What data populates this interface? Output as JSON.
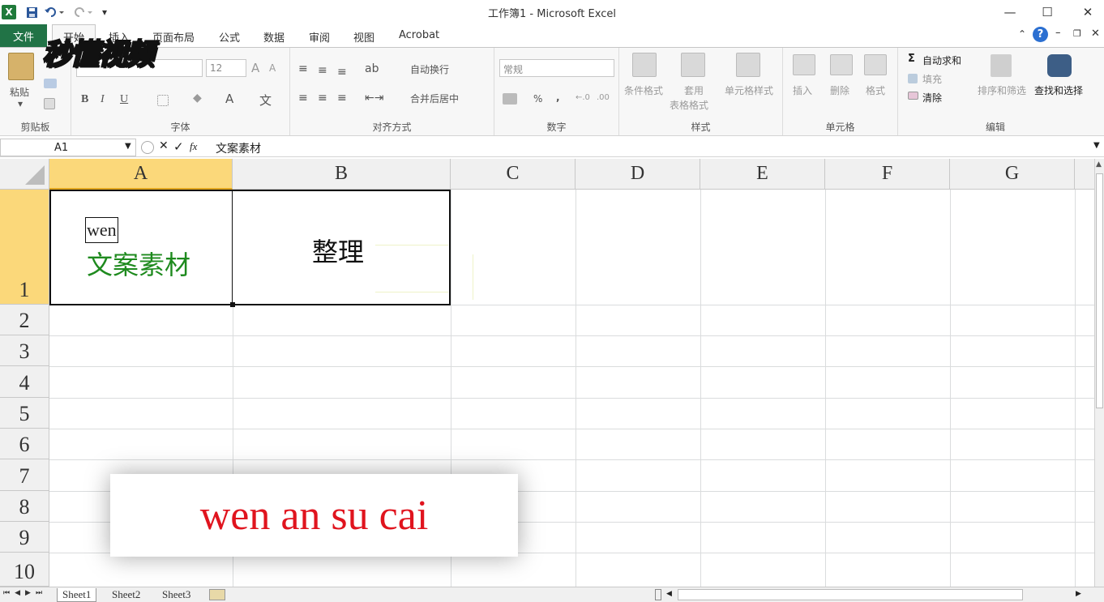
{
  "window": {
    "title": "工作簿1  -  Microsoft Excel",
    "app_logo": "X",
    "qat_dropdown": "▾"
  },
  "watermark": "秒懂视频",
  "ribbon": {
    "tabs": [
      "文件",
      "开始",
      "插入",
      "页面布局",
      "公式",
      "数据",
      "审阅",
      "视图",
      "Acrobat"
    ],
    "active_tab": "开始",
    "clipboard": {
      "paste": "粘贴",
      "label": "剪贴板"
    },
    "font": {
      "size": "12",
      "label": "字体",
      "bold": "B",
      "italic": "I",
      "underline": "U",
      "grow": "A",
      "shrink": "A",
      "color": "A",
      "phonetic": "文",
      "fill": "◆"
    },
    "alignment": {
      "wrap": "自动换行",
      "merge": "合并后居中",
      "label": "对齐方式"
    },
    "number": {
      "format": "常规",
      "percent": "%",
      "comma": ",",
      "inc": "←.0",
      "dec": ".00",
      "label": "数字"
    },
    "styles": {
      "conditional": "条件格式",
      "table1": "套用",
      "table2": "表格格式",
      "cell": "单元格样式",
      "label": "样式"
    },
    "cells": {
      "insert": "插入",
      "delete": "删除",
      "format": "格式",
      "label": "单元格"
    },
    "editing": {
      "autosum": "自动求和",
      "fill": "填充",
      "clear": "清除",
      "sort": "排序和筛选",
      "find": "查找和选择",
      "label": "编辑",
      "sigma": "Σ"
    }
  },
  "formula_bar": {
    "name_box": "A1",
    "cancel": "✕",
    "confirm": "✓",
    "fx": "fx",
    "content": "文案素材"
  },
  "columns": [
    "A",
    "B",
    "C",
    "D",
    "E",
    "F",
    "G"
  ],
  "rows": [
    "1",
    "2",
    "3",
    "4",
    "5",
    "6",
    "7",
    "8",
    "9",
    "10"
  ],
  "cells": {
    "A1_ime": "wen",
    "A1": "文案素材",
    "B1": "整理"
  },
  "sheets": [
    "Sheet1",
    "Sheet2",
    "Sheet3"
  ],
  "overlay_caption": "wen an su cai",
  "colors": {
    "excel_green": "#217346",
    "a1_text": "#1e8a1e",
    "caption_red": "#e0141e",
    "selected_header": "#fbd87a"
  }
}
